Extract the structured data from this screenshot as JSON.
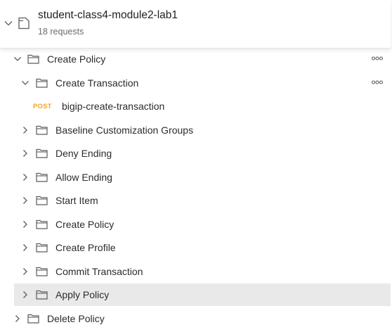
{
  "collection": {
    "name": "student-class4-module2-lab1",
    "request_count": "18 requests",
    "chevron_icon": "chevron-down-icon",
    "collection_icon": "collection-icon"
  },
  "tree": {
    "root_folder": {
      "label": "Create Policy",
      "expanded": true,
      "more_icon": "more-options-icon"
    },
    "create_transaction": {
      "label": "Create Transaction",
      "expanded": true,
      "more_icon": "more-options-icon"
    },
    "request": {
      "method": "POST",
      "label": "bigip-create-transaction",
      "method_color": "#f2a41a"
    },
    "folders": [
      {
        "label": "Baseline Customization Groups"
      },
      {
        "label": "Deny Ending"
      },
      {
        "label": "Allow Ending"
      },
      {
        "label": "Start Item"
      },
      {
        "label": "Create Policy"
      },
      {
        "label": "Create Profile"
      },
      {
        "label": "Commit Transaction"
      },
      {
        "label": "Apply Policy",
        "highlighted": true
      }
    ],
    "delete_folder": {
      "label": "Delete Policy",
      "expanded": false
    }
  },
  "colors": {
    "highlight": "#e9e9e9",
    "icon_stroke": "#5c5c5c",
    "post_method": "#f2a41a"
  }
}
